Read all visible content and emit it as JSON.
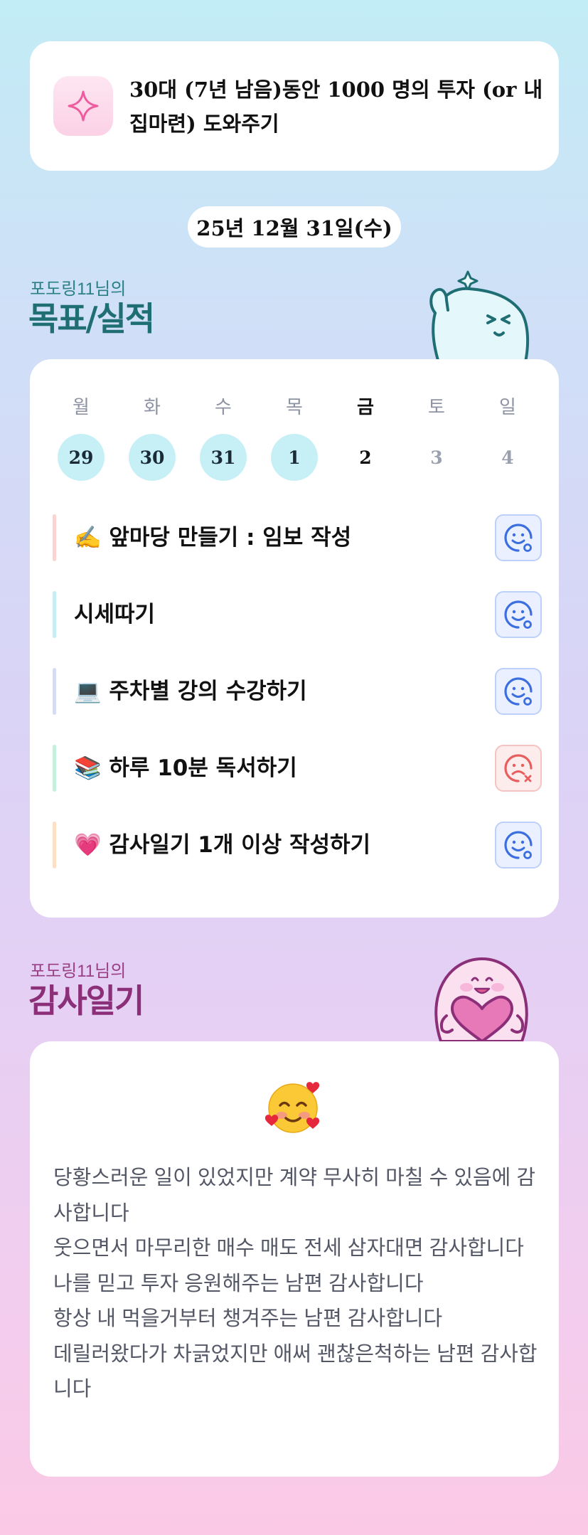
{
  "mission": {
    "icon": "sparkle-icon",
    "text": "30대 (7년 남음)동안 1000 명의 투자 (or 내 집마련) 도와주기"
  },
  "date_label": "25년 12월 31일(수)",
  "goals_section": {
    "subtitle": "포도링11님의",
    "title": "목표/실적"
  },
  "week": {
    "days": [
      "월",
      "화",
      "수",
      "목",
      "금",
      "토",
      "일"
    ],
    "dates": [
      "29",
      "30",
      "31",
      "1",
      "2",
      "3",
      "4"
    ],
    "today_index": 4
  },
  "tasks": [
    {
      "label": "✍️ 앞마당 만들기 : 임보 작성",
      "bar_color": "#fbd3d3",
      "status": "good"
    },
    {
      "label": "시세따기",
      "bar_color": "#c7eef2",
      "status": "good"
    },
    {
      "label": "💻 주차별 강의 수강하기",
      "bar_color": "#d5dcf3",
      "status": "good"
    },
    {
      "label": "📚 하루 10분 독서하기",
      "bar_color": "#c5f0db",
      "status": "bad"
    },
    {
      "label": "💗 감사일기 1개 이상 작성하기",
      "bar_color": "#fde1c4",
      "status": "good"
    }
  ],
  "gratitude_section": {
    "subtitle": "포도링11님의",
    "title": "감사일기",
    "emoji": "🥰",
    "lines": [
      "당황스러운 일이 있었지만 계약 무사히 마칠 수 있음에 감사합니다",
      "웃으면서 마무리한 매수 매도 전세 삼자대면 감사합니다",
      "나를 믿고 투자 응원해주는 남편 감사합니다",
      "항상 내 먹을거부터 챙겨주는 남편 감사합니다",
      "데릴러왔다가 차긁었지만 애써 괜찮은척하는 남편 감사합니다"
    ]
  },
  "colors": {
    "done_circle": "#c7f0f6",
    "good_face": "#3b6fe0",
    "bad_face": "#e85d5d"
  }
}
